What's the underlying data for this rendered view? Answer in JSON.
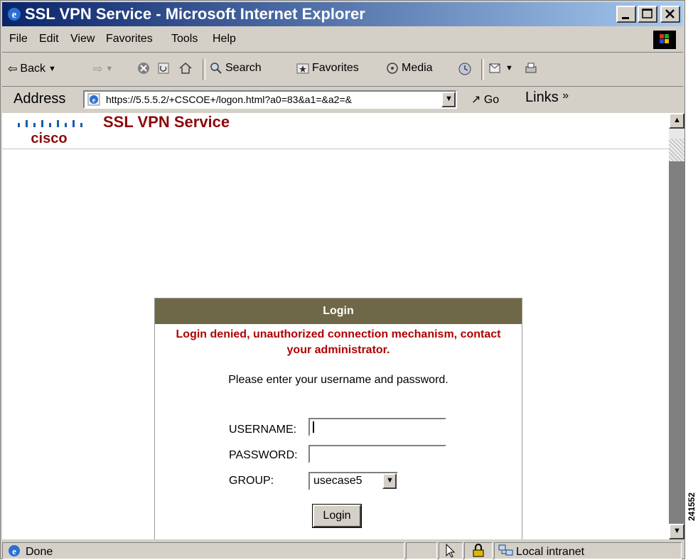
{
  "window": {
    "title": "SSL VPN Service - Microsoft Internet Explorer"
  },
  "menu": [
    "File",
    "Edit",
    "View",
    "Favorites",
    "Tools",
    "Help"
  ],
  "toolbar": {
    "back_label": "Back",
    "search_label": "Search",
    "favorites_label": "Favorites",
    "media_label": "Media"
  },
  "address": {
    "label": "Address",
    "url": "https://5.5.5.2/+CSCOE+/logon.html?a0=83&a1=&a2=&",
    "go_label": "Go",
    "links_label": "Links"
  },
  "page": {
    "brand": "cisco",
    "header_title": "SSL VPN Service",
    "login": {
      "heading": "Login",
      "error": "Login denied, unauthorized connection mechanism, contact your administrator.",
      "prompt": "Please enter your username and password.",
      "username_label": "USERNAME:",
      "username_value": "",
      "password_label": "PASSWORD:",
      "password_value": "",
      "group_label": "GROUP:",
      "group_value": "usecase5",
      "submit_label": "Login"
    }
  },
  "status": {
    "text": "Done",
    "zone": "Local intranet"
  },
  "figure_id": "241552"
}
